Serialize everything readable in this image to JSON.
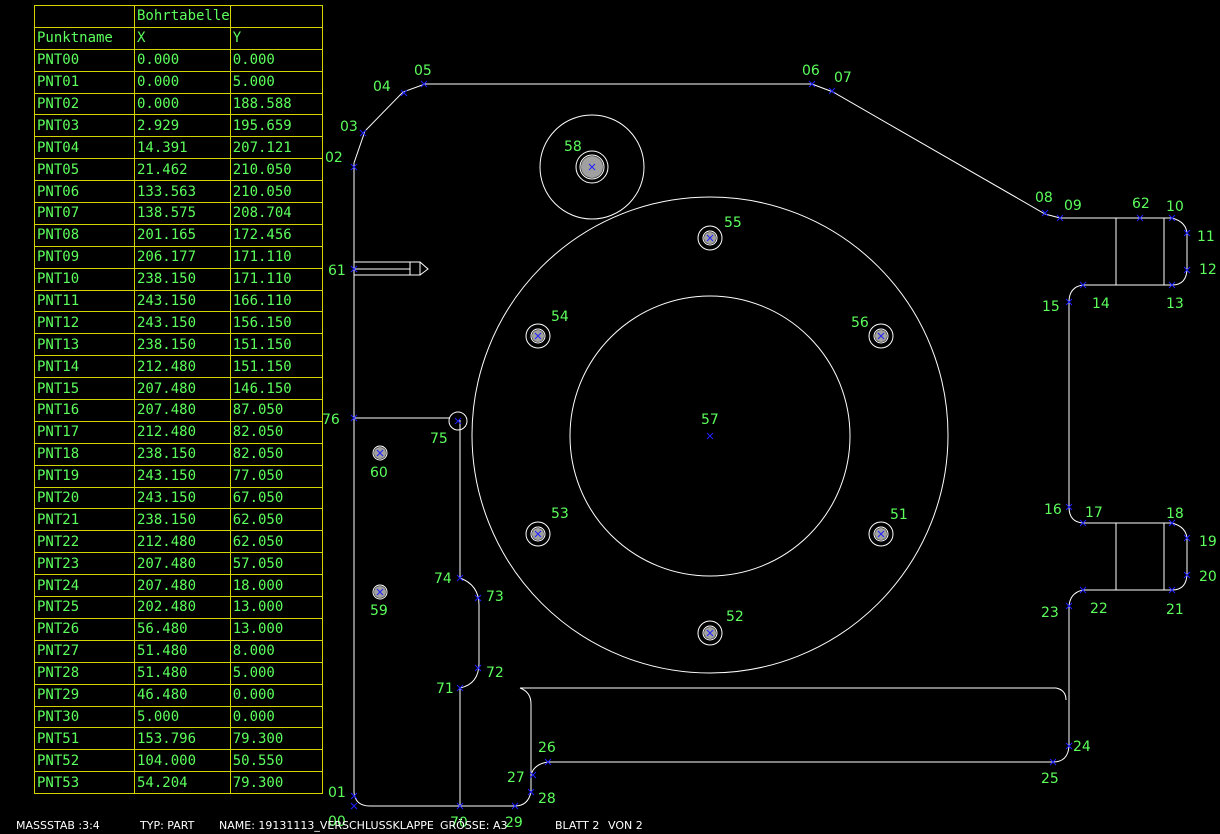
{
  "table": {
    "title": "Bohrtabelle",
    "headers": [
      "Punktname",
      "X",
      "Y"
    ],
    "rows": [
      [
        "PNT00",
        "0.000",
        "0.000"
      ],
      [
        "PNT01",
        "0.000",
        "5.000"
      ],
      [
        "PNT02",
        "0.000",
        "188.588"
      ],
      [
        "PNT03",
        "2.929",
        "195.659"
      ],
      [
        "PNT04",
        "14.391",
        "207.121"
      ],
      [
        "PNT05",
        "21.462",
        "210.050"
      ],
      [
        "PNT06",
        "133.563",
        "210.050"
      ],
      [
        "PNT07",
        "138.575",
        "208.704"
      ],
      [
        "PNT08",
        "201.165",
        "172.456"
      ],
      [
        "PNT09",
        "206.177",
        "171.110"
      ],
      [
        "PNT10",
        "238.150",
        "171.110"
      ],
      [
        "PNT11",
        "243.150",
        "166.110"
      ],
      [
        "PNT12",
        "243.150",
        "156.150"
      ],
      [
        "PNT13",
        "238.150",
        "151.150"
      ],
      [
        "PNT14",
        "212.480",
        "151.150"
      ],
      [
        "PNT15",
        "207.480",
        "146.150"
      ],
      [
        "PNT16",
        "207.480",
        "87.050"
      ],
      [
        "PNT17",
        "212.480",
        "82.050"
      ],
      [
        "PNT18",
        "238.150",
        "82.050"
      ],
      [
        "PNT19",
        "243.150",
        "77.050"
      ],
      [
        "PNT20",
        "243.150",
        "67.050"
      ],
      [
        "PNT21",
        "238.150",
        "62.050"
      ],
      [
        "PNT22",
        "212.480",
        "62.050"
      ],
      [
        "PNT23",
        "207.480",
        "57.050"
      ],
      [
        "PNT24",
        "207.480",
        "18.000"
      ],
      [
        "PNT25",
        "202.480",
        "13.000"
      ],
      [
        "PNT26",
        "56.480",
        "13.000"
      ],
      [
        "PNT27",
        "51.480",
        "8.000"
      ],
      [
        "PNT28",
        "51.480",
        "5.000"
      ],
      [
        "PNT29",
        "46.480",
        "0.000"
      ],
      [
        "PNT30",
        "5.000",
        "0.000"
      ],
      [
        "PNT51",
        "153.796",
        "79.300"
      ],
      [
        "PNT52",
        "104.000",
        "50.550"
      ],
      [
        "PNT53",
        "54.204",
        "79.300"
      ]
    ]
  },
  "point_labels": [
    {
      "t": "00"
    },
    {
      "t": "01"
    },
    {
      "t": "02"
    },
    {
      "t": "03"
    },
    {
      "t": "04"
    },
    {
      "t": "05"
    },
    {
      "t": "06"
    },
    {
      "t": "07"
    },
    {
      "t": "08"
    },
    {
      "t": "09"
    },
    {
      "t": "62"
    },
    {
      "t": "10"
    },
    {
      "t": "11"
    },
    {
      "t": "12"
    },
    {
      "t": "13"
    },
    {
      "t": "14"
    },
    {
      "t": "15"
    },
    {
      "t": "16"
    },
    {
      "t": "17"
    },
    {
      "t": "18"
    },
    {
      "t": "19"
    },
    {
      "t": "20"
    },
    {
      "t": "21"
    },
    {
      "t": "22"
    },
    {
      "t": "23"
    },
    {
      "t": "24"
    },
    {
      "t": "25"
    },
    {
      "t": "26"
    },
    {
      "t": "27"
    },
    {
      "t": "28"
    },
    {
      "t": "29"
    },
    {
      "t": "70"
    },
    {
      "t": "71"
    },
    {
      "t": "72"
    },
    {
      "t": "73"
    },
    {
      "t": "74"
    },
    {
      "t": "75"
    },
    {
      "t": "76"
    },
    {
      "t": "61"
    },
    {
      "t": "58"
    },
    {
      "t": "55"
    },
    {
      "t": "54"
    },
    {
      "t": "56"
    },
    {
      "t": "57"
    },
    {
      "t": "53"
    },
    {
      "t": "51"
    },
    {
      "t": "52"
    },
    {
      "t": "60"
    },
    {
      "t": "59"
    }
  ],
  "status_bar": {
    "scale": "MASSSTAB :3:4",
    "type": "TYP: PART",
    "name": "NAME: 19131113_VERSCHLUSSKLAPPE",
    "size": "GRÖSSE: A3",
    "sheet": "BLATT 2",
    "of": "VON 2"
  },
  "colors": {
    "background": "#000000",
    "lines": "#ffffff",
    "labels": "#5cff5c",
    "table_border": "#d4d400",
    "markers": "#2020ff"
  }
}
